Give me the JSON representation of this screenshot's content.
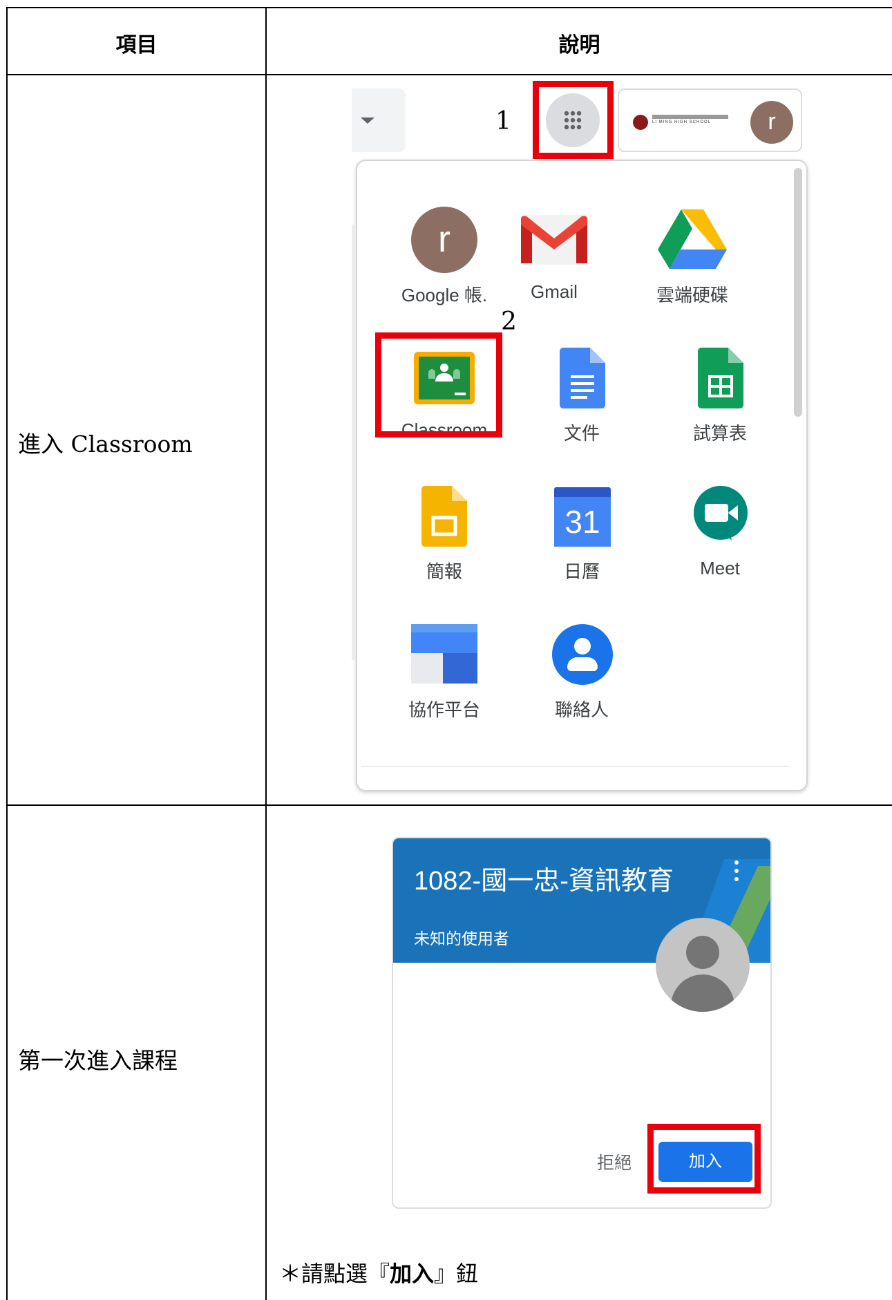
{
  "table": {
    "header": {
      "item": "項目",
      "description": "說明"
    },
    "rows": [
      {
        "label": "進入 Classroom"
      },
      {
        "label": "第一次進入課程"
      }
    ]
  },
  "launcher": {
    "step1": "1",
    "step2": "2",
    "account_avatar_letter": "r",
    "school_logo_text": "LI MING HIGH SCHOOL",
    "apps": [
      {
        "label": "Google 帳.",
        "icon": "account-avatar-icon",
        "avatar_letter": "r"
      },
      {
        "label": "Gmail",
        "icon": "gmail-icon"
      },
      {
        "label": "雲端硬碟",
        "icon": "drive-icon"
      },
      {
        "label": "Classroom",
        "icon": "classroom-icon"
      },
      {
        "label": "文件",
        "icon": "docs-icon"
      },
      {
        "label": "試算表",
        "icon": "sheets-icon"
      },
      {
        "label": "簡報",
        "icon": "slides-icon"
      },
      {
        "label": "日曆",
        "icon": "calendar-icon",
        "calendar_day": "31"
      },
      {
        "label": "Meet",
        "icon": "meet-icon"
      },
      {
        "label": "協作平台",
        "icon": "sites-icon"
      },
      {
        "label": "聯絡人",
        "icon": "contacts-icon"
      }
    ]
  },
  "class_card": {
    "title": "1082-國一忠-資訊教育",
    "subtitle": "未知的使用者",
    "decline": "拒絕",
    "join": "加入",
    "header_color": "#1a73b8"
  },
  "note": {
    "prefix": "＊請點選『",
    "bold": "加入",
    "suffix": "』鈕"
  },
  "colors": {
    "highlight": "#e8000b",
    "join_button": "#1a73e8"
  }
}
